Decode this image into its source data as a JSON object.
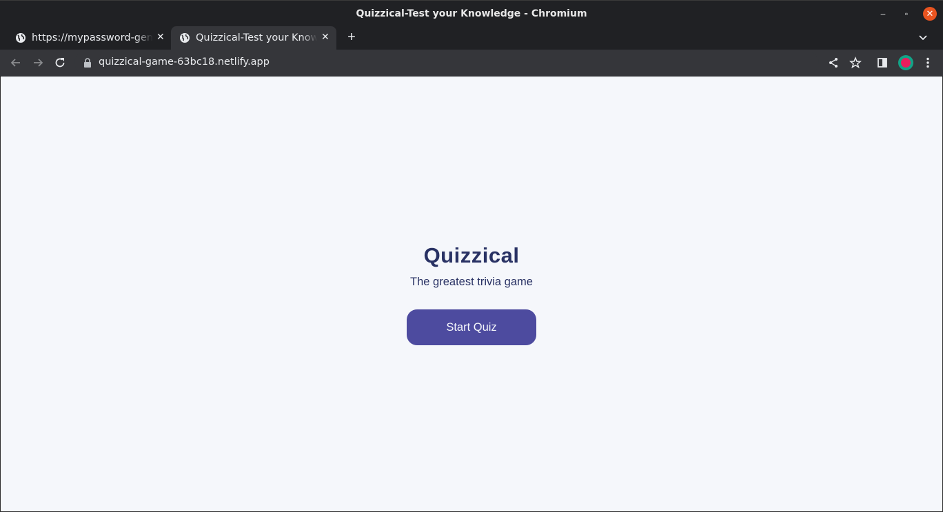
{
  "window": {
    "title": "Quizzical-Test your Knowledge - Chromium",
    "minimize_glyph": "–",
    "maximize_glyph": "▫",
    "close_glyph": "✕"
  },
  "tabs": [
    {
      "label": "https://mypassword-generator",
      "favicon": "globe-icon",
      "active": false,
      "close_glyph": "✕"
    },
    {
      "label": "Quizzical-Test your Knowledge",
      "favicon": "globe-icon",
      "active": true,
      "close_glyph": "✕"
    }
  ],
  "new_tab_glyph": "+",
  "toolbar": {
    "url": "quizzical-game-63bc18.netlify.app",
    "icons": [
      "back-arrow-icon",
      "forward-arrow-icon",
      "reload-icon",
      "lock-icon",
      "share-icon",
      "bookmark-star-icon",
      "side-panel-icon",
      "profile-avatar",
      "more-menu-icon"
    ]
  },
  "page": {
    "title": "Quizzical",
    "subtitle": "The greatest trivia game",
    "start_button": "Start Quiz"
  },
  "colors": {
    "page_background": "#f5f7fb",
    "title_color": "#293264",
    "button_background": "#4d4b9f",
    "button_text": "#f5f7fb",
    "browser_dark": "#202124",
    "toolbar": "#35363a",
    "close_button": "#e95420"
  }
}
